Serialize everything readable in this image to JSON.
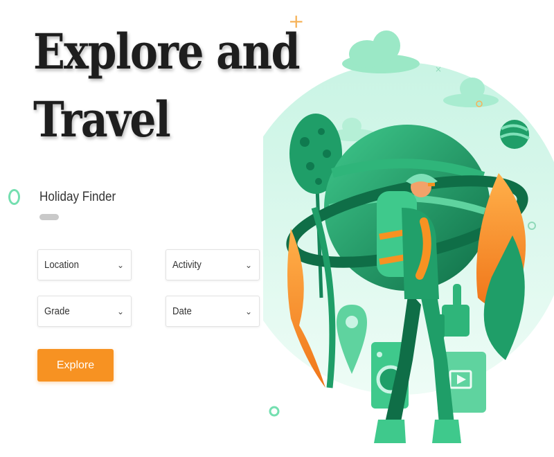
{
  "hero": {
    "line1": "Explore and",
    "line2": "Travel"
  },
  "finder": {
    "title": "Holiday Finder"
  },
  "filters": [
    {
      "label": "Location"
    },
    {
      "label": "Activity"
    },
    {
      "label": "Grade"
    },
    {
      "label": "Date"
    }
  ],
  "explore_button": {
    "label": "Explore"
  },
  "colors": {
    "accent_orange": "#f79222",
    "ring_mint": "#74dfb0",
    "green_dark": "#0f7a4f",
    "green_mid": "#21a06a",
    "green_light": "#7fe0b8"
  },
  "icons": [
    "chevron-down-icon",
    "ring-icon",
    "play-icon",
    "thumbs-up-icon",
    "location-pin-icon"
  ]
}
